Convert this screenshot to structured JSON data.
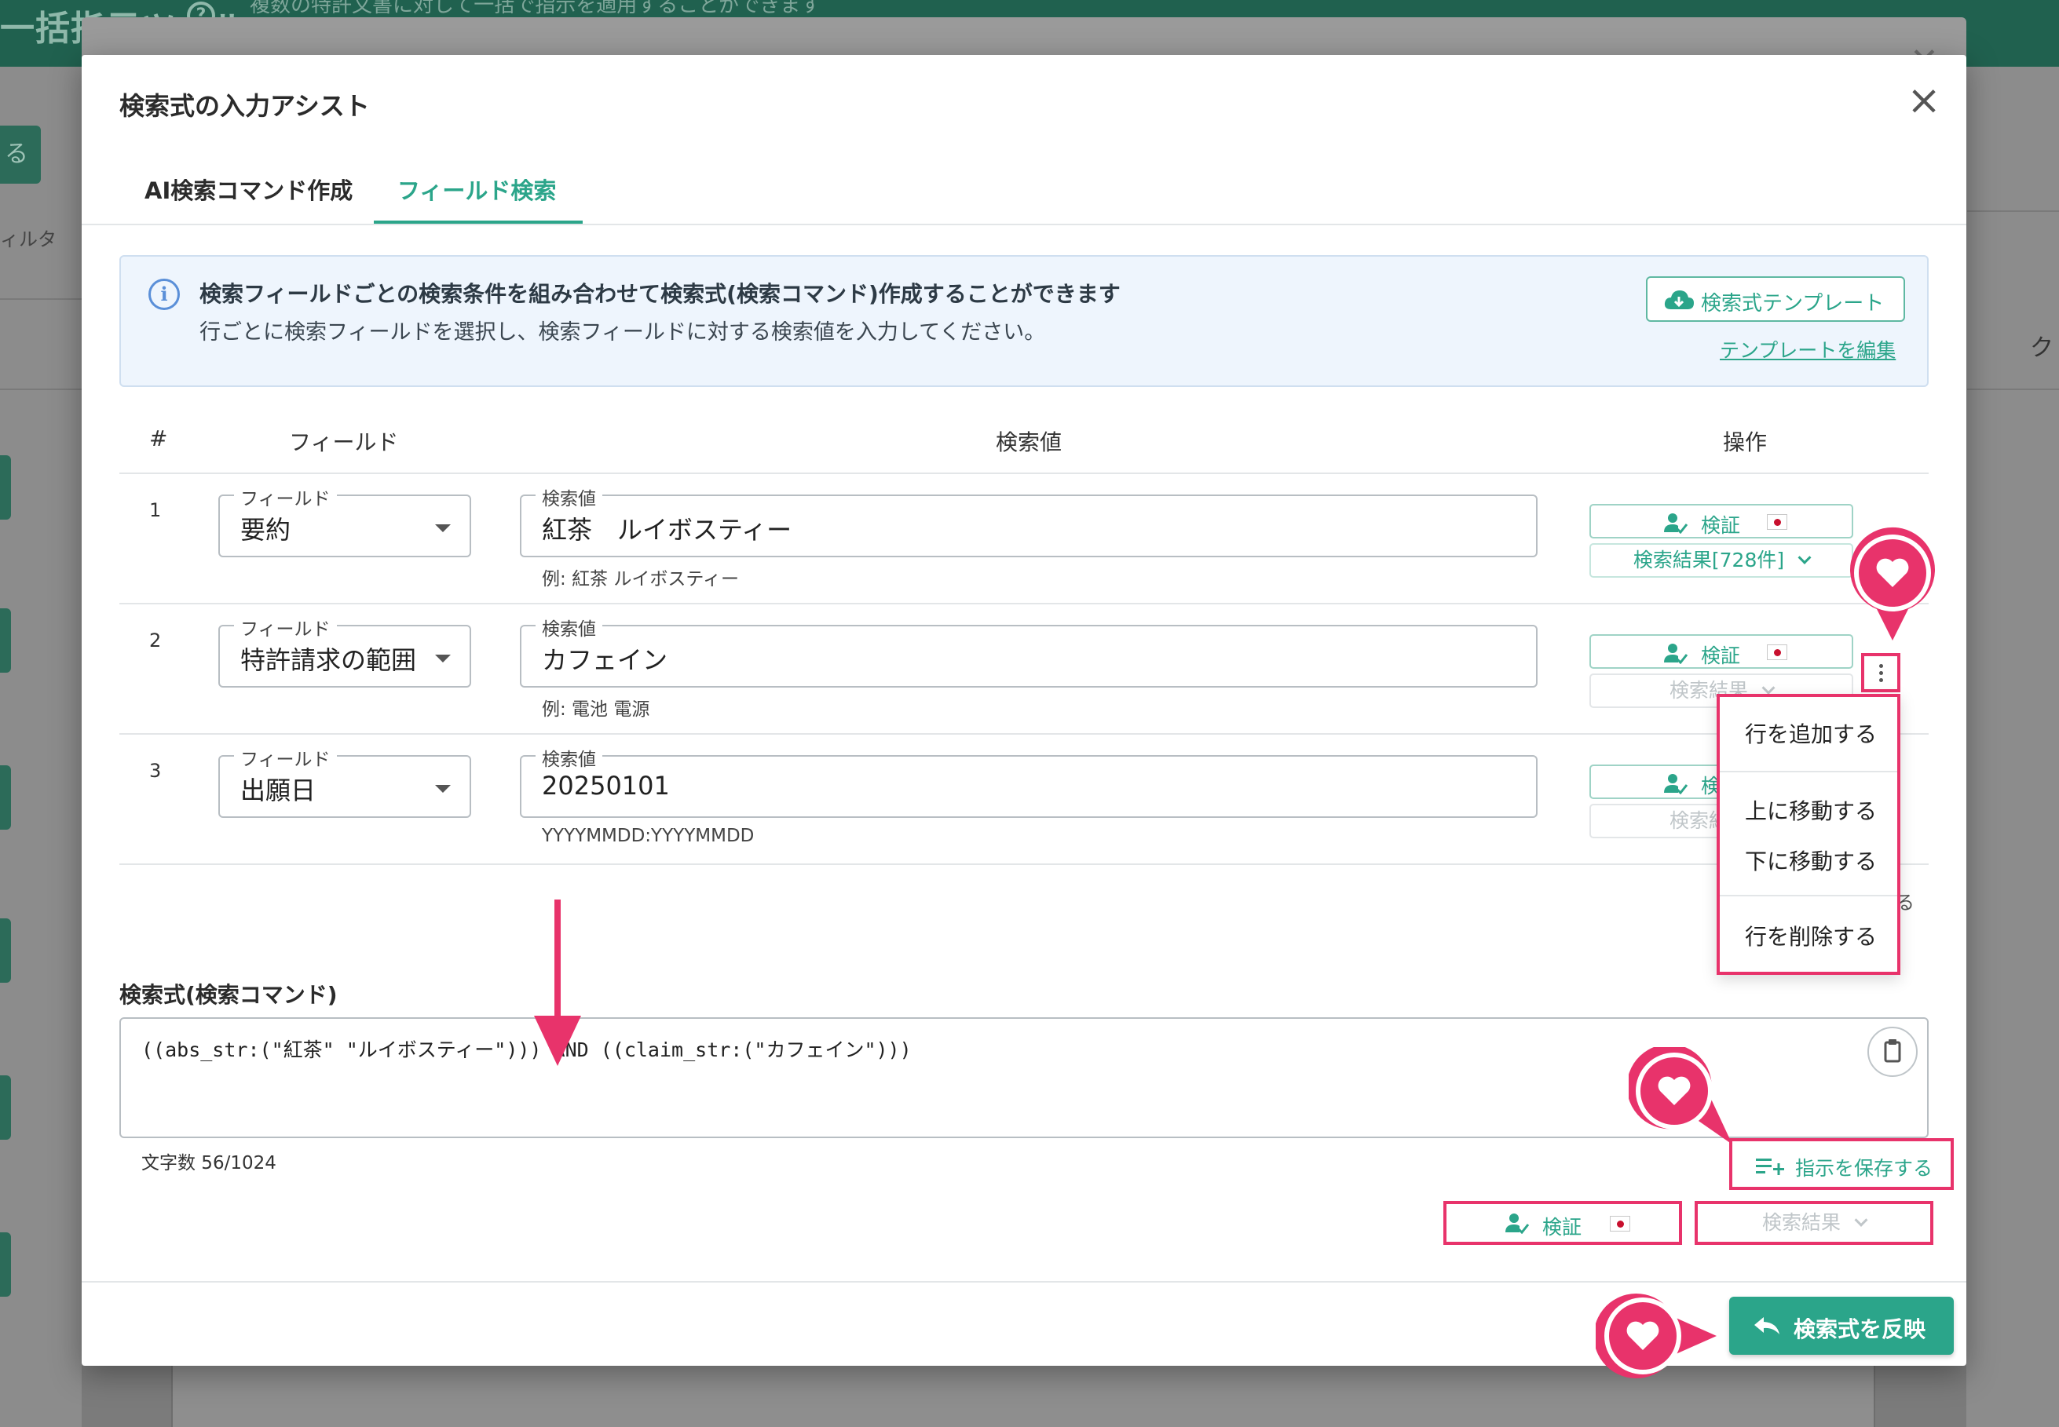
{
  "background": {
    "app_title": "一括指示ツール",
    "app_description": "複数の特許文書に対して一括で指示を適用することができます",
    "left_button_label": "る",
    "filter_label": "ィルタ",
    "right_header": "ク"
  },
  "modal": {
    "title": "検索式の入力アシスト",
    "tabs": [
      {
        "label": "AI検索コマンド作成",
        "active": false
      },
      {
        "label": "フィールド検索",
        "active": true
      }
    ],
    "info": {
      "title": "検索フィールドごとの検索条件を組み合わせて検索式(検索コマンド)作成することができます",
      "text": "行ごとに検索フィールドを選択し、検索フィールドに対する検索値を入力してください。",
      "template_button": "検索式テンプレート",
      "template_edit_link": "テンプレートを編集"
    },
    "table": {
      "headers": {
        "num": "#",
        "field": "フィールド",
        "value": "検索値",
        "op": "操作"
      },
      "field_legend": "フィールド",
      "value_legend": "検索値",
      "verify_label": "検証",
      "rows": [
        {
          "num": "1",
          "field": "要約",
          "value": "紅茶　ルイボスティー",
          "hint": "例: 紅茶 ルイボスティー",
          "results": "検索結果[728件]",
          "results_enabled": true
        },
        {
          "num": "2",
          "field": "特許請求の範囲",
          "value": "カフェイン",
          "hint": "例: 電池 電源",
          "results": "検索結果",
          "results_enabled": false
        },
        {
          "num": "3",
          "field": "出願日",
          "value": "20250101",
          "hint": "YYYYMMDD:YYYYMMDD",
          "results": "検索結果",
          "results_enabled": false
        }
      ],
      "partial_right_text": "る"
    },
    "row_menu": {
      "items": [
        "行を追加する",
        "上に移動する",
        "下に移動する",
        "行を削除する"
      ]
    },
    "expression": {
      "label": "検索式(検索コマンド)",
      "value": "((abs_str:(\"紅茶\" \"ルイボスティー\"))) AND ((claim_str:(\"カフェイン\")))",
      "char_count": "文字数 56/1024"
    },
    "save_button": "指示を保存する",
    "verify_button": "検証",
    "results_button": "検索結果",
    "apply_button": "検索式を反映"
  },
  "colors": {
    "accent": "#2ba58a",
    "highlight": "#e8336b",
    "info_bg": "#eef5fd",
    "header_bg": "#20614f"
  }
}
